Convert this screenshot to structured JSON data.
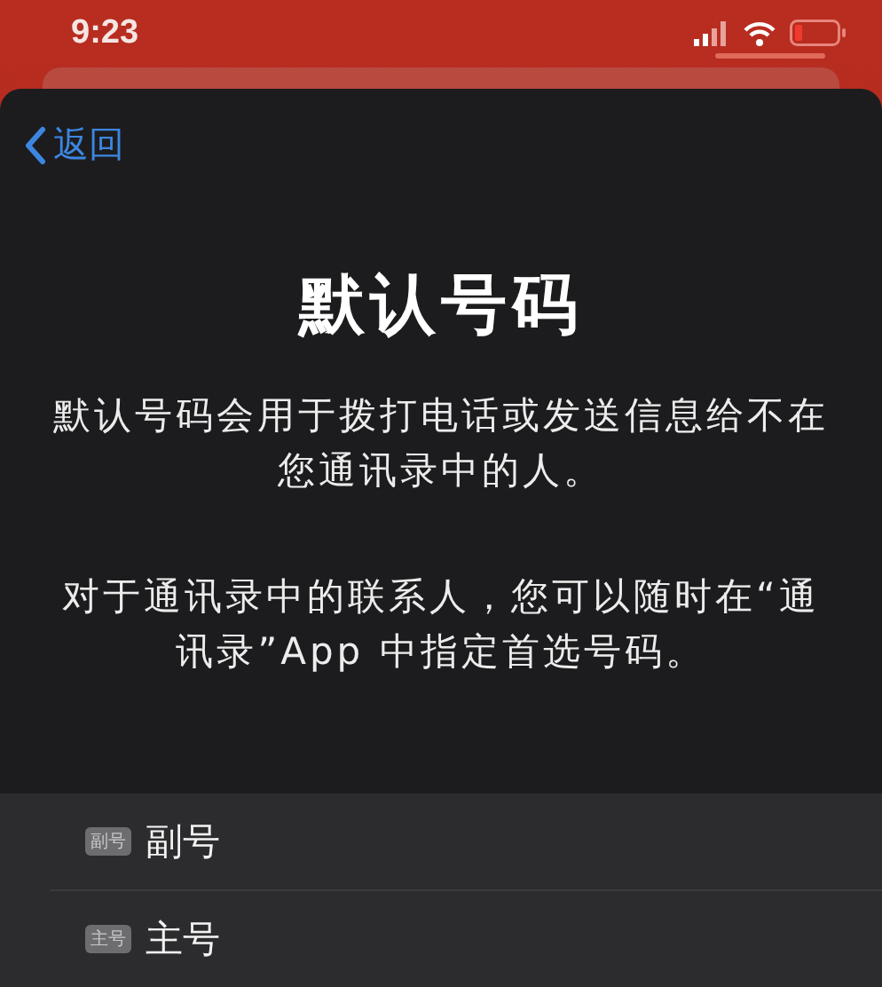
{
  "status_bar": {
    "time": "9:23"
  },
  "nav": {
    "back": "返回"
  },
  "title": "默认号码",
  "paragraphs": [
    "默认号码会用于拨打电话或发送信息给不在您通讯录中的人。",
    "对于通讯录中的联系人，您可以随时在“通讯录”App 中指定首选号码。"
  ],
  "lines": [
    {
      "badge": "副号",
      "label": "副号"
    },
    {
      "badge": "主号",
      "label": "主号"
    }
  ]
}
